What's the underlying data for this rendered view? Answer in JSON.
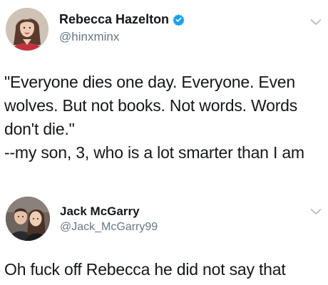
{
  "tweets": [
    {
      "author": {
        "display_name": "Rebecca Hazelton",
        "handle": "@hinxminx",
        "verified": true,
        "avatar": "woman-portrait"
      },
      "text_lines": [
        "\"Everyone dies one day. Everyone. Even",
        "wolves. But not books. Not words. Words",
        "don't die.\"",
        "--my son, 3, who is a lot smarter than I am"
      ]
    },
    {
      "author": {
        "display_name": "Jack McGarry",
        "handle": "@Jack_McGarry99",
        "verified": false,
        "avatar": "couple-portrait"
      },
      "text_lines": [
        "Oh fuck off Rebecca he did not say that"
      ]
    }
  ],
  "icons": {
    "verified": "verified-badge-icon",
    "menu": "chevron-down-icon"
  },
  "colors": {
    "verified_blue": "#1da1f2",
    "handle_gray": "#657786",
    "text": "#14171a",
    "chevron": "#aab8c2"
  }
}
